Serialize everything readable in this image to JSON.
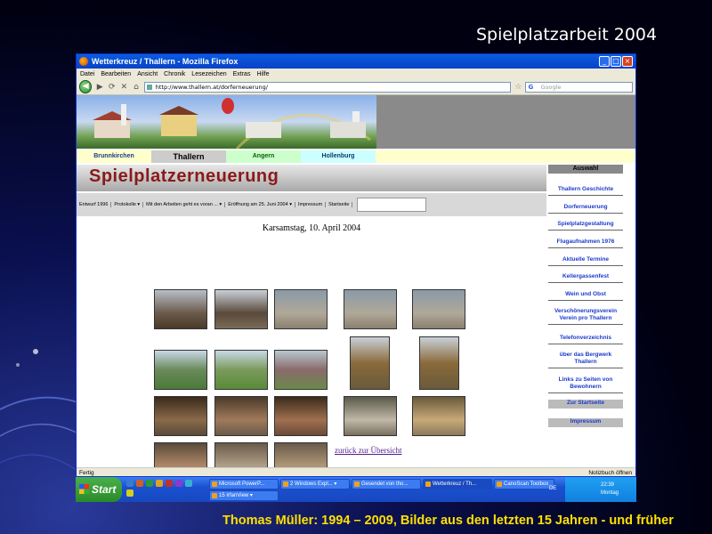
{
  "slide": {
    "title": "Spielplatzarbeit 2004",
    "caption": "Thomas Müller: 1994 – 2009, Bilder aus den letzten 15 Jahren - und früher"
  },
  "browser": {
    "title": "Wetterkreuz / Thallern - Mozilla Firefox",
    "menu": [
      "Datei",
      "Bearbeiten",
      "Ansicht",
      "Chronik",
      "Lesezeichen",
      "Extras",
      "Hilfe"
    ],
    "url": "http://www.thallern.at/dorferneuerung/",
    "search_placeholder": "Google",
    "status": "Fertig",
    "status_right": "Notizbuch öffnen"
  },
  "site": {
    "tabs": [
      "Brunnkirchen",
      "Thallern",
      "Angern",
      "Hollenburg"
    ],
    "headline": "Spielplatzerneuerung",
    "subnav": [
      "Entwurf 1996",
      "Protokolle ▾",
      "Mit den Arbeiten geht es voran ... ▾",
      "Eröffnung am 25. Juni 2004 ▾",
      "Impressum",
      "Startseite"
    ],
    "date": "Karsamstag, 10. April 2004",
    "back_link": "zurück zur Übersicht",
    "sidebar_title": "Auswahl",
    "sidebar": [
      "Thallern Geschichte",
      "Dorferneuerung",
      "Spielplatzgestaltung",
      "Flugaufnahmen 1976",
      "Aktuelle Termine",
      "Kellergassenfest",
      "Wein und Obst",
      "Verschönerungsverein Verein pro Thallern",
      "Telefonverzeichnis",
      "über das Bergwerk Thallern",
      "Links zu Seiten von Bewohnern",
      "Zur Startseite",
      "Impressum"
    ]
  },
  "taskbar": {
    "start": "Start",
    "tasks": [
      "Microsoft PowerP...",
      "2 Windows Expl... ▾",
      "Gesendet von tho...",
      "Wetterkreuz / Th...",
      "CanoScan Toolbox",
      "15 IrfanView ▾"
    ],
    "lang": "DE",
    "time": "22:39",
    "day": "Montag"
  }
}
